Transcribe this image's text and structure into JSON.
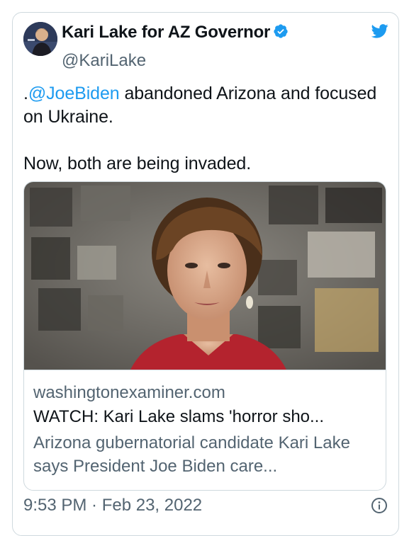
{
  "tweet": {
    "display_name": "Kari Lake for AZ Governor",
    "handle": "@KariLake",
    "text_prefix": ".",
    "mention": "@JoeBiden",
    "text_line1_rest": " abandoned Arizona and focused on Ukraine.",
    "text_line2": "Now, both are being invaded.",
    "timestamp": "9:53 PM · Feb 23, 2022"
  },
  "card": {
    "domain": "washingtonexaminer.com",
    "title": "WATCH: Kari Lake slams 'horror sho...",
    "description": "Arizona gubernatorial candidate Kari Lake says President Joe Biden care..."
  },
  "colors": {
    "link_blue": "#1d9bf0",
    "twitter_blue": "#1d9bf0",
    "verified_blue": "#1d9bf0",
    "text_dark": "#0f1419",
    "text_gray": "#536471",
    "border": "#cfd9de"
  },
  "icons": {
    "logo": "twitter-bird-icon",
    "verified": "verified-badge-icon",
    "info": "info-icon"
  }
}
